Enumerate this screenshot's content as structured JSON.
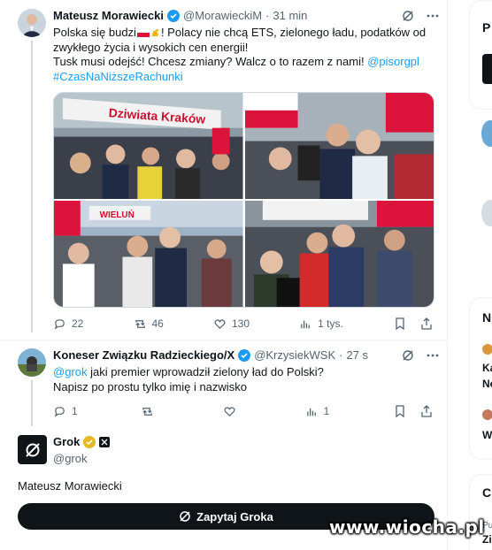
{
  "tweet1": {
    "author_name": "Mateusz Morawiecki",
    "handle": "@MorawieckiM",
    "separator": "·",
    "time": "31 min",
    "text_line1": "Polska się budzi",
    "text_line1_end": "! Polacy nie chcą ETS, zielonego ładu, podatków od",
    "text_line2": "zwykłego życia i wysokich cen energii!",
    "text_line3": "Tusk musi odejść! Chcesz zmiany? Walcz o to razem z nami! ",
    "mention": "@pisorgpl",
    "hashtag": "#CzasNaNiższeRachunki",
    "banner_text": "Dziwiata Kraków",
    "banner_text2": "WIELUŃ",
    "replies": "22",
    "retweets": "46",
    "likes": "130",
    "views": "1 tys."
  },
  "tweet2": {
    "author_name": "Koneser Związku Radzieckiego/X",
    "handle": "@KrzysiekWSK",
    "separator": "·",
    "time": "27 s",
    "mention": "@grok",
    "text_line1": " jaki premier wprowadził zielony ład do Polski?",
    "text_line2": "Napisz po prostu tylko imię i nazwisko",
    "replies": "1",
    "retweets": "",
    "likes": "",
    "views": "1"
  },
  "grok": {
    "name": "Grok",
    "handle": "@grok",
    "answer": "Mateusz Morawiecki",
    "ask_button": "Zapytaj Groka"
  },
  "sidebar": {
    "letter1": "P",
    "letter2": "N",
    "item1": "Ka",
    "item2": "Ne",
    "item3": "W",
    "letter3": "C",
    "item4": "Pu",
    "item5": "Zi"
  },
  "watermark": "www.wiocha.pl",
  "colors": {
    "accent": "#1d9bf0",
    "text": "#0f1419",
    "muted": "#536471",
    "verified_gold": "#e8b923",
    "polish_red": "#dc143c"
  }
}
